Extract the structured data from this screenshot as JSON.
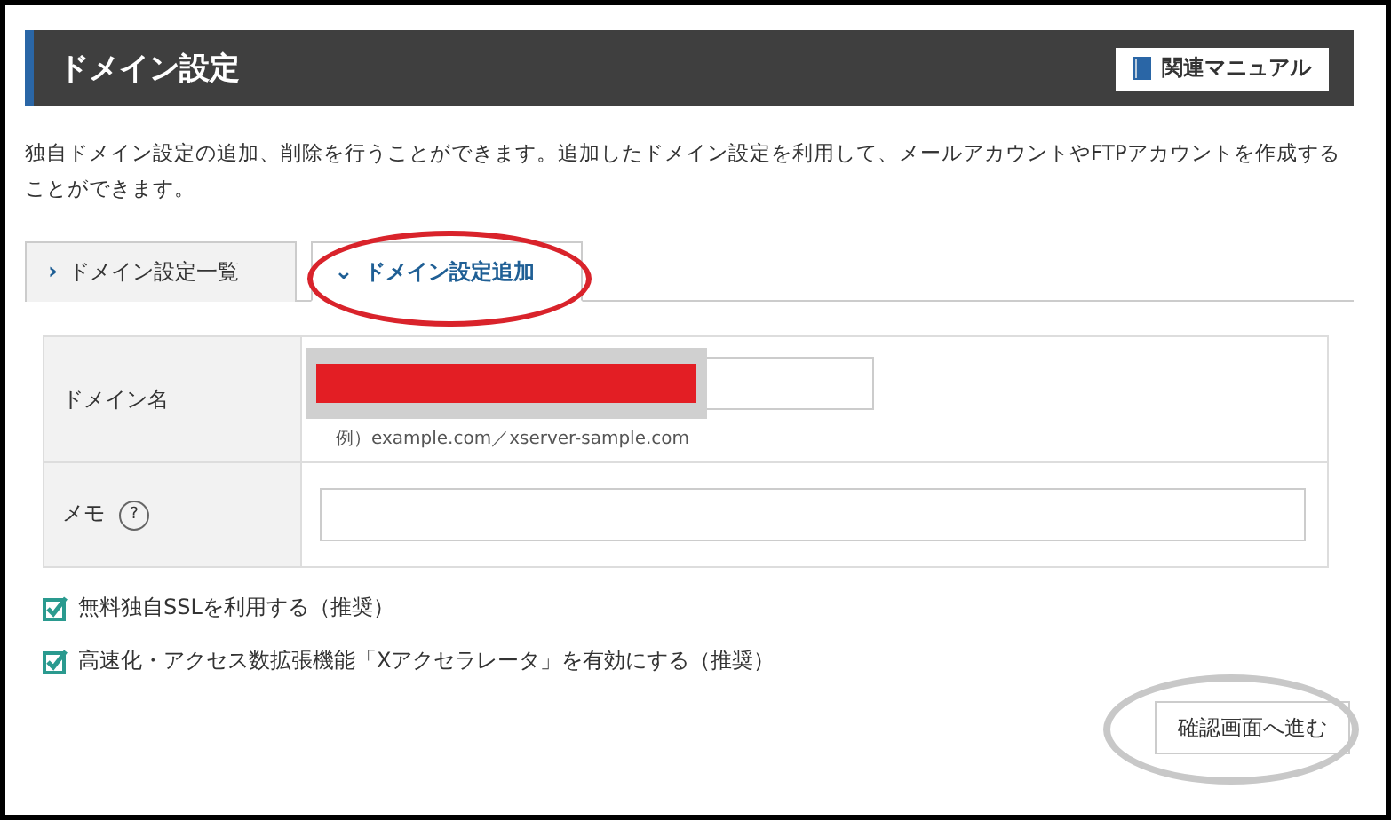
{
  "header": {
    "title": "ドメイン設定",
    "manual_button": "関連マニュアル"
  },
  "description": "独自ドメイン設定の追加、削除を行うことができます。追加したドメイン設定を利用して、メールアカウントやFTPアカウントを作成することができます。",
  "tabs": [
    {
      "icon": "›",
      "label": "ドメイン設定一覧",
      "selected": false
    },
    {
      "icon": "⌄",
      "label": "ドメイン設定追加",
      "selected": true
    }
  ],
  "form": [
    {
      "kind": "domain",
      "label": "ドメイン名",
      "hint": "例）example.com／xserver-sample.com"
    },
    {
      "kind": "memo",
      "label": "メモ",
      "help": "?"
    }
  ],
  "options": [
    {
      "label": "無料独自SSLを利用する（推奨）",
      "checked": true
    },
    {
      "label": "高速化・アクセス数拡張機能「Xアクセラレータ」を有効にする（推奨）",
      "checked": true
    }
  ],
  "submit_button": "確認画面へ進む"
}
